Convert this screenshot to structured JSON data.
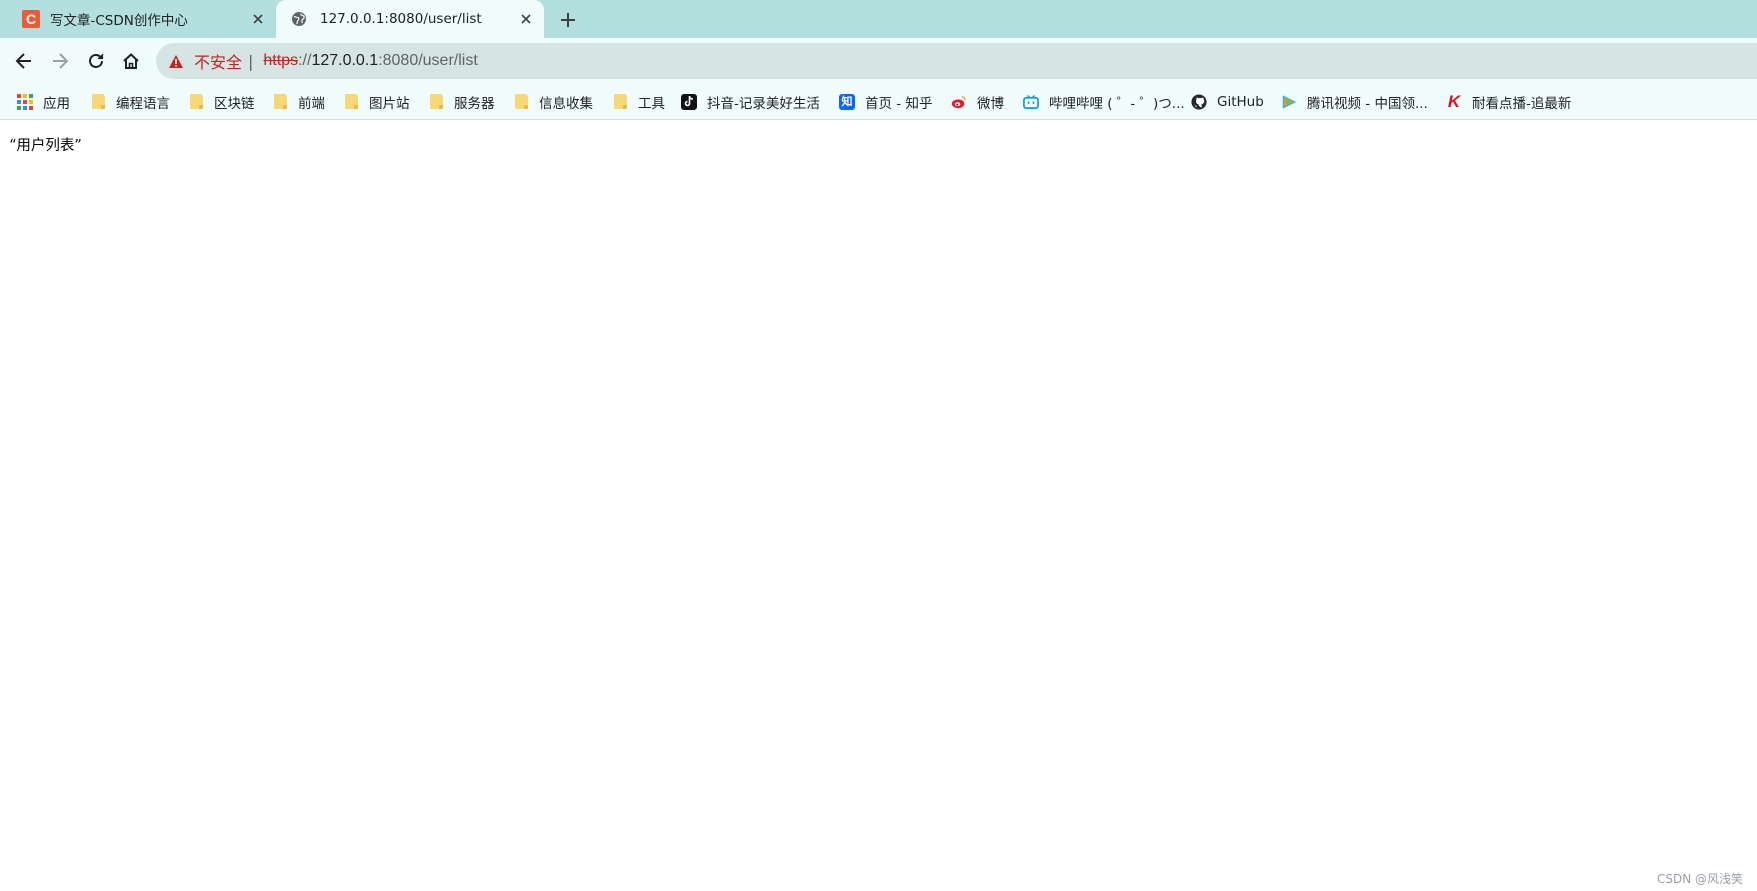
{
  "tabs": [
    {
      "title": "写文章-CSDN创作中心",
      "favicon": "csdn-icon",
      "favicon_text": "C",
      "active": false
    },
    {
      "title": "127.0.0.1:8080/user/list",
      "favicon": "globe-icon",
      "active": true
    }
  ],
  "omnibox": {
    "security_label": "不安全",
    "separator": "|",
    "url_scheme": "https",
    "url_scheme_sep": "://",
    "url_host": "127.0.0.1",
    "url_rest": ":8080/user/list"
  },
  "bookmarks": [
    {
      "label": "应用",
      "icon": "apps-grid-icon"
    },
    {
      "label": "编程语言",
      "icon": "folder-icon"
    },
    {
      "label": "区块链",
      "icon": "folder-icon"
    },
    {
      "label": "前端",
      "icon": "folder-icon"
    },
    {
      "label": "图片站",
      "icon": "folder-icon"
    },
    {
      "label": "服务器",
      "icon": "folder-icon"
    },
    {
      "label": "信息收集",
      "icon": "folder-icon"
    },
    {
      "label": "工具",
      "icon": "folder-icon"
    },
    {
      "label": "抖音-记录美好生活",
      "icon": "douyin-icon"
    },
    {
      "label": "首页 - 知乎",
      "icon": "zhihu-icon",
      "icon_text": "知"
    },
    {
      "label": "微博",
      "icon": "weibo-icon"
    },
    {
      "label": "哔哩哔哩 ( ゜- ゜)つ...",
      "icon": "bilibili-icon"
    },
    {
      "label": "GitHub",
      "icon": "github-icon"
    },
    {
      "label": "腾讯视频 - 中国领...",
      "icon": "tencent-video-icon"
    },
    {
      "label": "耐看点播-追最新",
      "icon": "naikan-icon",
      "icon_text": "K"
    }
  ],
  "page": {
    "body_text": "“用户列表”"
  },
  "watermark": "CSDN @风浅笑",
  "colors": {
    "tab_strip": "#b3dfdf",
    "toolbar": "#f1fdfd",
    "omnibox": "#d7e4e4",
    "insecure_red": "#c5221f"
  }
}
